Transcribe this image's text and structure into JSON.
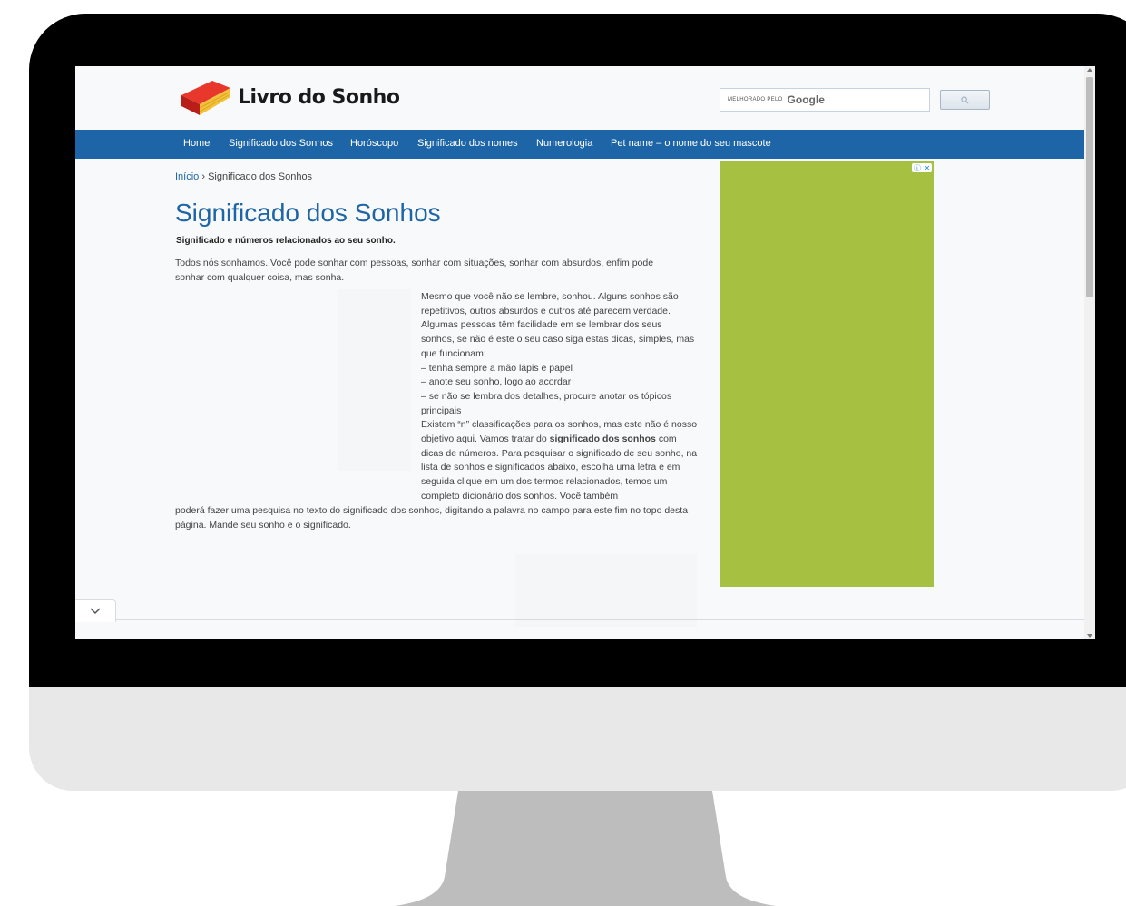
{
  "site": {
    "logo_text": "Livro do Sonho"
  },
  "search": {
    "powered_label": "MELHORADO PELO",
    "brand": "Google"
  },
  "nav": {
    "items": [
      "Home",
      "Significado dos Sonhos",
      "Horóscopo",
      "Significado dos nomes",
      "Numerologia",
      "Pet name – o nome do seu mascote"
    ]
  },
  "breadcrumb": {
    "home": "Início",
    "separator": "›",
    "current": "Significado dos Sonhos"
  },
  "main": {
    "title": "Significado dos Sonhos",
    "subtitle": "Significado e números relacionados ao seu sonho.",
    "intro": "Todos nós sonhamos. Você pode sonhar com pessoas, sonhar com situações, sonhar com absurdos, enfim pode sonhar com qualquer coisa, mas sonha.",
    "column": {
      "p1": "Mesmo que você não se lembre, sonhou. Alguns sonhos são repetitivos, outros absurdos e outros até parecem verdade. Algumas pessoas têm facilidade em se lembrar dos seus sonhos, se não é este o seu caso siga estas dicas, simples, mas que funcionam:",
      "tip1": "– tenha sempre a mão lápis e papel",
      "tip2": "– anote seu sonho, logo ao acordar",
      "tip3": "– se não se lembra dos detalhes, procure anotar os tópicos principais",
      "p2_before": "Existem “n” classificações para os sonhos, mas este não é nosso objetivo aqui. Vamos tratar do ",
      "p2_bold": "significado dos sonhos",
      "p2_after": " com dicas de números. Para pesquisar o significado de seu sonho, na lista de sonhos e significados abaixo, escolha uma letra e em seguida clique em um dos termos relacionados, temos um completo dicionário dos sonhos. Você também"
    },
    "tail": "poderá fazer uma pesquisa no texto do significado dos sonhos, digitando a palavra no campo para este fim no topo desta página. Mande seu sonho e o significado."
  },
  "ad": {
    "color": "#a6c142",
    "info_icon": "ⓘ",
    "close_icon": "✕"
  },
  "colors": {
    "brand_blue": "#1d65a6",
    "nav_text": "#ffffff"
  }
}
